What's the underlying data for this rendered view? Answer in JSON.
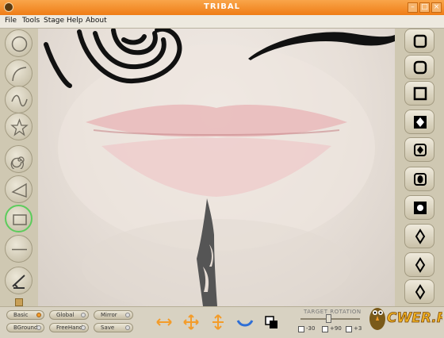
{
  "window": {
    "title": "TRIBAL",
    "controls": [
      "minimize",
      "maximize",
      "close"
    ]
  },
  "menu": {
    "items": [
      "File",
      "Tools",
      "Stage",
      "Help",
      "About"
    ]
  },
  "toolbar_left": {
    "tools": [
      {
        "icon": "circle-tool-icon"
      },
      {
        "icon": "arc-tool-icon"
      },
      {
        "icon": "wave-tool-icon"
      },
      {
        "icon": "star-tool-icon"
      },
      {
        "icon": "spiral-tool-icon"
      },
      {
        "icon": "triangle-tool-icon"
      },
      {
        "icon": "rectangle-tool-icon",
        "selected": true
      },
      {
        "icon": "line-tool-icon"
      },
      {
        "icon": "brush-tool-icon"
      }
    ]
  },
  "shape_library": {
    "icons": [
      "rounded-square-shape-icon",
      "rounded-square-shape-icon",
      "square-shape-icon",
      "diamond-in-square-shape-icon",
      "diamond-in-square-shape-icon",
      "circle-in-square-shape-icon",
      "circle-in-square-shape-icon",
      "diamond-shape-icon",
      "diamond-shape-icon",
      "diamond-shape-icon"
    ]
  },
  "bottom": {
    "buttons": [
      {
        "label": "Basic",
        "on": true
      },
      {
        "label": "Global",
        "on": false
      },
      {
        "label": "Mirror",
        "on": false
      },
      {
        "label": "BGround",
        "on": false
      },
      {
        "label": "FreeHand",
        "on": false
      },
      {
        "label": "Save",
        "on": false
      }
    ],
    "actions": [
      "move-horizontal-icon",
      "move-all-icon",
      "move-vertical-icon",
      "flip-icon",
      "layer-order-icon"
    ],
    "rotation": {
      "label": "TARGET ROTATION",
      "options": [
        "-30",
        "+90",
        "+3"
      ]
    }
  },
  "watermark": "CWER.RU",
  "colors": {
    "titlebar": "#ef7d16",
    "tattoo_ink": "#111111",
    "selected_ring": "#5ccc5c",
    "active_dot": "#f39c2a"
  }
}
